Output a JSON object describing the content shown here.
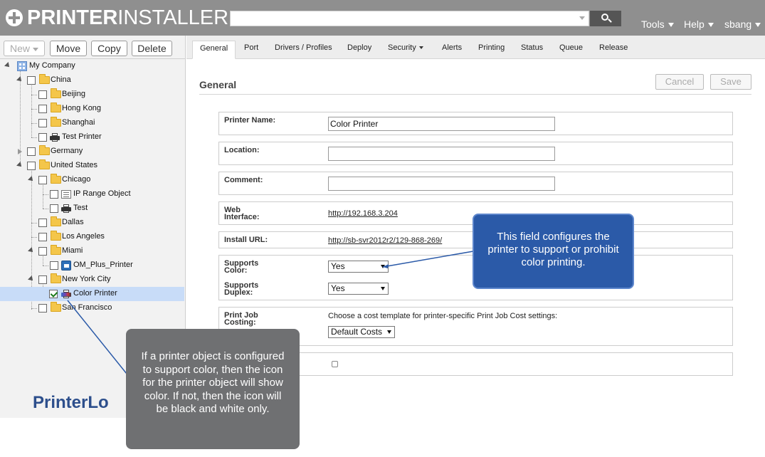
{
  "header": {
    "logo_bold": "PRINTER",
    "logo_light": "INSTALLER",
    "search_placeholder": "",
    "menus": [
      "Tools",
      "Help",
      "sbang"
    ]
  },
  "toolbar": {
    "new_label": "New",
    "move_label": "Move",
    "copy_label": "Copy",
    "delete_label": "Delete"
  },
  "tree": {
    "items": [
      {
        "label": "My Company",
        "icon": "company-icon"
      },
      {
        "label": "China",
        "icon": "folder-icon",
        "expanded": true
      },
      {
        "label": "Beijing",
        "icon": "folder-icon"
      },
      {
        "label": "Hong Kong",
        "icon": "folder-icon"
      },
      {
        "label": "Shanghai",
        "icon": "folder-icon"
      },
      {
        "label": "Test Printer",
        "icon": "printer-icon"
      },
      {
        "label": "Germany",
        "icon": "folder-icon",
        "expanded": false
      },
      {
        "label": "United States",
        "icon": "folder-icon",
        "expanded": true
      },
      {
        "label": "Chicago",
        "icon": "folder-icon",
        "expanded": true
      },
      {
        "label": "IP Range Object",
        "icon": "ip-range-icon"
      },
      {
        "label": "Test",
        "icon": "printer-icon"
      },
      {
        "label": "Dallas",
        "icon": "folder-icon"
      },
      {
        "label": "Los Angeles",
        "icon": "folder-icon"
      },
      {
        "label": "Miami",
        "icon": "folder-icon",
        "expanded": true
      },
      {
        "label": "OM_Plus_Printer",
        "icon": "om-plus-icon"
      },
      {
        "label": "New York City",
        "icon": "folder-icon",
        "expanded": true
      },
      {
        "label": "Color Printer",
        "icon": "color-printer-icon",
        "selected": true,
        "checked": true
      },
      {
        "label": "San Francisco",
        "icon": "folder-icon"
      }
    ]
  },
  "brand_bottom": "PrinterLo",
  "tabs": [
    "General",
    "Port",
    "Drivers / Profiles",
    "Deploy",
    "Security",
    "Alerts",
    "Printing",
    "Status",
    "Queue",
    "Release"
  ],
  "main": {
    "section_title": "General",
    "cancel_label": "Cancel",
    "save_label": "Save",
    "printer_name_label": "Printer Name:",
    "printer_name_value": "Color Printer",
    "location_label": "Location:",
    "location_value": "",
    "comment_label": "Comment:",
    "comment_value": "",
    "web_interface_label_1": "Web",
    "web_interface_label_2": "Interface:",
    "web_interface_value": "http://192.168.3.204",
    "install_url_label": "Install URL:",
    "install_url_value": "http://sb-svr2012r2/129-868-269/",
    "supports_color_label_1": "Supports",
    "supports_color_label_2": "Color:",
    "supports_color_value": "Yes",
    "supports_duplex_label_1": "Supports",
    "supports_duplex_label_2": "Duplex:",
    "supports_duplex_value": "Yes",
    "print_job_label_1": "Print Job",
    "print_job_label_2": "Costing:",
    "cost_note": "Choose a cost template for printer-specific Print Job Cost settings:",
    "cost_template_value": "Default Costs"
  },
  "callouts": {
    "blue_text": "This field configures the printer to support or prohibit color printing.",
    "gray_text": "If a printer object is configured to support color, then the icon for the printer object will show color. If not, then the icon will be black and white only."
  },
  "colors": {
    "header_bg": "#8f8f8f",
    "callout_blue": "#2b5aa8",
    "callout_gray": "#6f7072",
    "selection": "#c8dcf8",
    "brand": "#2d4f8c"
  }
}
